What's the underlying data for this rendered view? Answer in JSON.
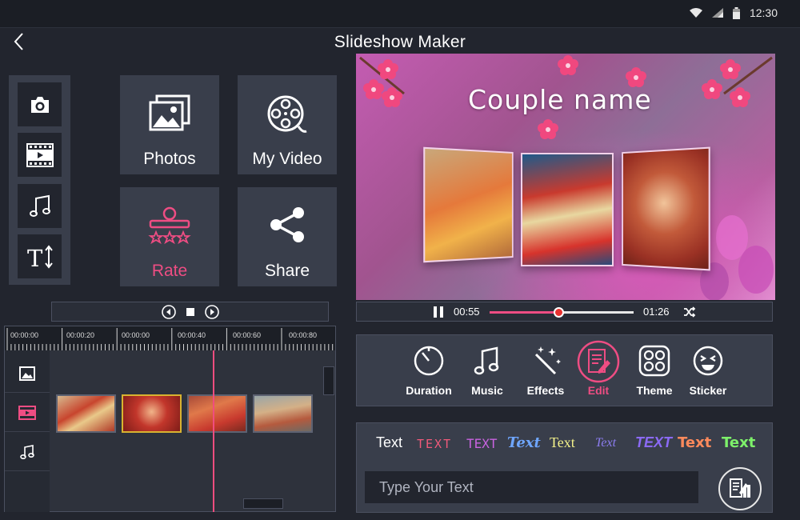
{
  "status": {
    "time": "12:30"
  },
  "header": {
    "title": "Slideshow Maker"
  },
  "tiles": {
    "photos": "Photos",
    "my_video": "My Video",
    "rate": "Rate",
    "share": "Share"
  },
  "preview": {
    "title": "Couple name"
  },
  "player": {
    "current_time": "00:55",
    "total_time": "01:26",
    "progress": 0.48
  },
  "timeline": {
    "ruler": [
      "00:00:00",
      "00:00:20",
      "00:00:00",
      "00:00:40",
      "00:00:60",
      "00:00:80"
    ]
  },
  "edit_tools": {
    "duration": "Duration",
    "music": "Music",
    "effects": "Effects",
    "edit": "Edit",
    "theme": "Theme",
    "sticker": "Sticker"
  },
  "text_panel": {
    "styles": [
      "Text",
      "TEXT",
      "TEXT",
      "Text",
      "Text",
      "Text",
      "TEXT",
      "Text",
      "Text"
    ],
    "placeholder": "Type Your Text"
  },
  "colors": {
    "accent": "#ee4d83",
    "panel": "#393e4b",
    "background": "#22252e"
  }
}
